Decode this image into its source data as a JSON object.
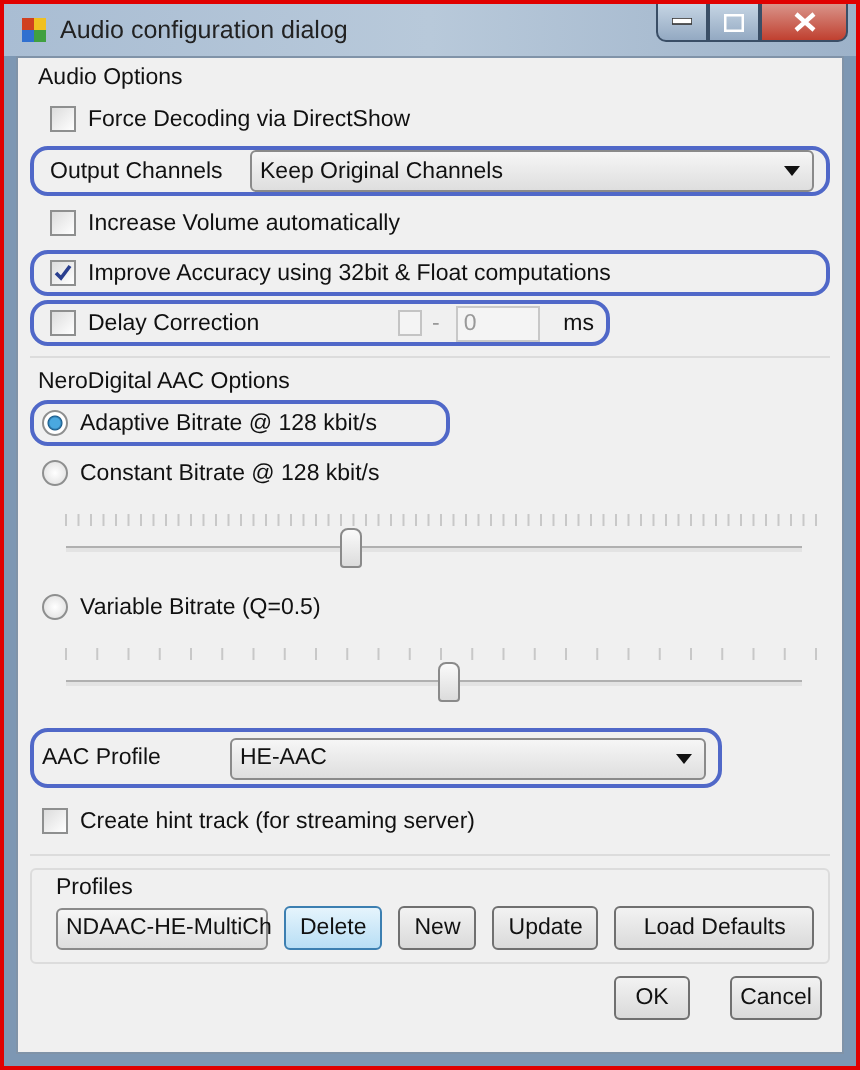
{
  "window": {
    "title": "Audio configuration dialog"
  },
  "audio_options": {
    "title": "Audio Options",
    "items": [
      {
        "kind": "checkbox",
        "label": "Force Decoding via DirectShow",
        "checked": false,
        "highlighted": false
      },
      {
        "kind": "dropdown",
        "label": "Output Channels",
        "value": "Keep Original Channels",
        "highlighted": true
      },
      {
        "kind": "checkbox",
        "label": "Increase Volume automatically",
        "checked": false,
        "highlighted": false
      },
      {
        "kind": "checkbox",
        "label": "Improve Accuracy using 32bit & Float computations",
        "checked": true,
        "highlighted": true
      },
      {
        "kind": "delay",
        "label": "Delay Correction",
        "checked": false,
        "negative_checked": false,
        "sign": "-",
        "value": "0",
        "unit": "ms",
        "disabled": true,
        "highlighted": true
      }
    ]
  },
  "aac_options": {
    "title": "NeroDigital AAC Options",
    "items": [
      {
        "kind": "radio",
        "label": "Adaptive Bitrate @ 128 kbit/s",
        "selected": true,
        "highlighted": true
      },
      {
        "kind": "radio",
        "label": "Constant Bitrate @ 128 kbit/s",
        "selected": false,
        "highlighted": false
      },
      {
        "kind": "slider",
        "level": 0.37
      },
      {
        "kind": "radio",
        "label": "Variable Bitrate (Q=0.5)",
        "selected": false,
        "highlighted": false
      },
      {
        "kind": "slider",
        "level": 0.5
      },
      {
        "kind": "dropdown",
        "label": "AAC Profile",
        "value": "HE-AAC",
        "highlighted": true
      },
      {
        "kind": "checkbox",
        "label": "Create hint track (for streaming server)",
        "checked": false,
        "highlighted": false
      }
    ]
  },
  "profiles": {
    "title": "Profiles",
    "value": "NDAAC-HE-MultiCh",
    "buttons": [
      {
        "label": "Delete",
        "focused": true
      },
      {
        "label": "New",
        "focused": false
      },
      {
        "label": "Update",
        "focused": false
      },
      {
        "label": "Load Defaults",
        "focused": false
      }
    ]
  },
  "buttons": [
    "OK",
    "Cancel"
  ]
}
